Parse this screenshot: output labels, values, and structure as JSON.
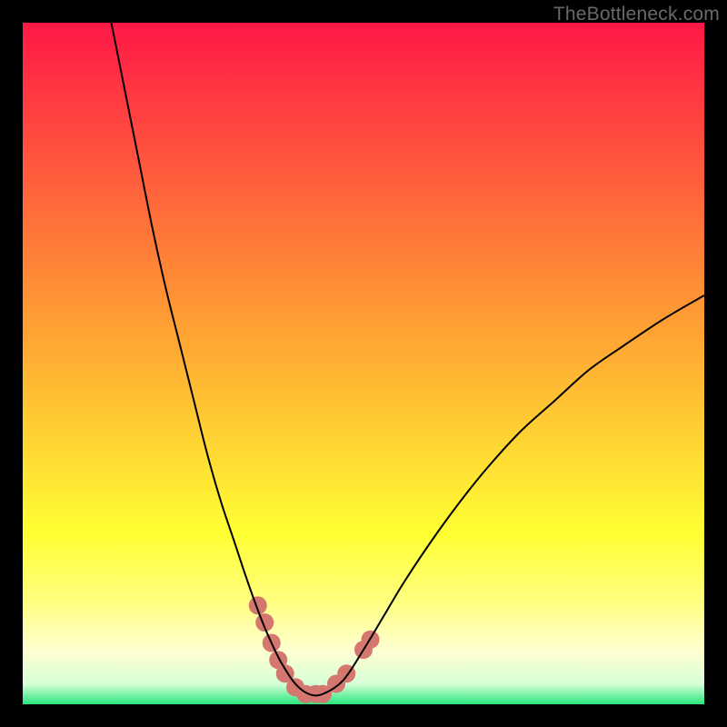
{
  "watermark": "TheBottleneck.com",
  "chart_data": {
    "type": "line",
    "title": "",
    "xlabel": "",
    "ylabel": "",
    "xlim": [
      0,
      100
    ],
    "ylim": [
      0,
      100
    ],
    "legend": false,
    "grid": false,
    "background_gradient": {
      "direction": "vertical",
      "stops": [
        {
          "offset": 0.0,
          "color": "#ff1846"
        },
        {
          "offset": 0.45,
          "color": "#ffa133"
        },
        {
          "offset": 0.75,
          "color": "#ffff33"
        },
        {
          "offset": 0.85,
          "color": "#ffff80"
        },
        {
          "offset": 0.92,
          "color": "#ffffd0"
        },
        {
          "offset": 0.97,
          "color": "#d8ffd8"
        },
        {
          "offset": 1.0,
          "color": "#28e67c"
        }
      ]
    },
    "series": [
      {
        "name": "curve",
        "color": "#000000",
        "stroke_width": 2,
        "x": [
          13,
          15,
          17,
          19,
          21,
          23,
          25,
          27,
          29,
          31,
          33,
          35,
          36.5,
          38,
          40,
          42,
          44,
          47,
          50,
          53,
          56,
          60,
          64,
          68,
          73,
          78,
          83,
          88,
          94,
          100
        ],
        "values": [
          100,
          90,
          80,
          70,
          61,
          53,
          45,
          37,
          30,
          24,
          18,
          12.5,
          9,
          6,
          3,
          1.5,
          1.5,
          3.5,
          8,
          13,
          18,
          24,
          29.5,
          34.5,
          40,
          44.5,
          49,
          52.5,
          56.5,
          60
        ]
      }
    ],
    "highlights": {
      "comment": "Thick salmon dots near the minimum of the curve",
      "color": "#d4776f",
      "radius": 10,
      "points": [
        {
          "x": 34.5,
          "y": 14.5
        },
        {
          "x": 35.5,
          "y": 12.0
        },
        {
          "x": 36.5,
          "y": 9.0
        },
        {
          "x": 37.5,
          "y": 6.5
        },
        {
          "x": 38.5,
          "y": 4.5
        },
        {
          "x": 40.0,
          "y": 2.5
        },
        {
          "x": 41.5,
          "y": 1.5
        },
        {
          "x": 43.0,
          "y": 1.5
        },
        {
          "x": 44.0,
          "y": 1.5
        },
        {
          "x": 46.0,
          "y": 3.0
        },
        {
          "x": 47.5,
          "y": 4.5
        },
        {
          "x": 50.0,
          "y": 8.0
        },
        {
          "x": 51.0,
          "y": 9.5
        }
      ]
    }
  }
}
